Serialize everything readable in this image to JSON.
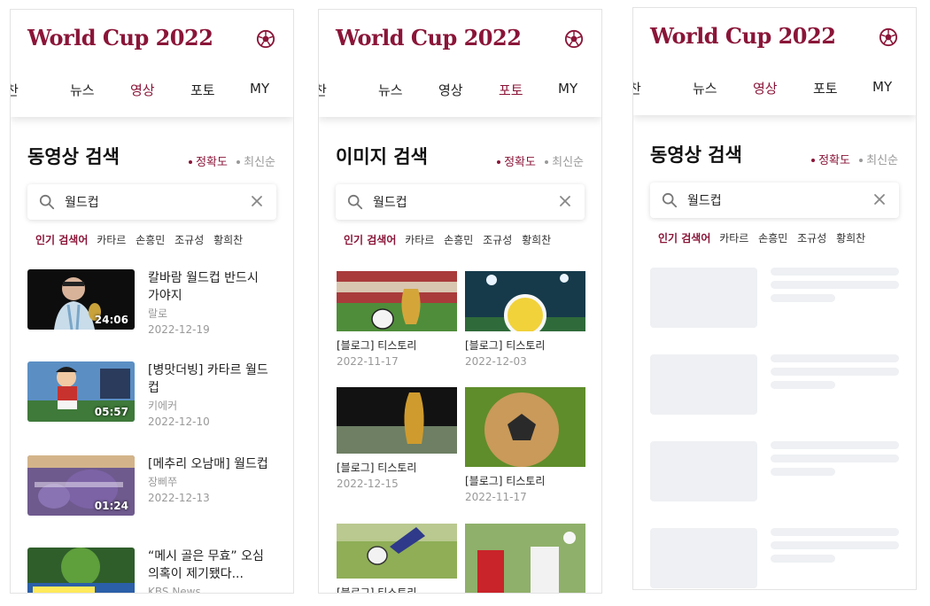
{
  "logo": "World Cup 2022",
  "tabs": [
    "찬",
    "뉴스",
    "영상",
    "포토",
    "MY"
  ],
  "sort": {
    "accuracy": "정확도",
    "latest": "최신순"
  },
  "search": {
    "value": "월드컵"
  },
  "popular": {
    "label": "인기 검색어",
    "keywords": [
      "카타르",
      "손흥민",
      "조규성",
      "황희찬"
    ]
  },
  "screens": [
    {
      "title": "동영상 검색",
      "active_tab": "영상",
      "videos": [
        {
          "title": "칼바람 월드컵 반드시 가야지",
          "channel": "랄로",
          "date": "2022-12-19",
          "duration": "24:06"
        },
        {
          "title": "[병맛더빙] 카타르 월드컵",
          "channel": "키에커",
          "date": "2022-12-10",
          "duration": "05:57"
        },
        {
          "title": "[메추리 오남매] 월드컵",
          "channel": "장삐쭈",
          "date": "2022-12-13",
          "duration": "01:24"
        },
        {
          "title": "“메시 골은 무효” 오심 의혹이 제기됐다...",
          "channel": "KBS News",
          "date": "",
          "duration": ""
        }
      ]
    },
    {
      "title": "이미지 검색",
      "active_tab": "포토",
      "images": [
        {
          "caption": "[블로그] 티스토리",
          "date": "2022-11-17"
        },
        {
          "caption": "[블로그] 티스토리",
          "date": "2022-12-03"
        },
        {
          "caption": "[블로그] 티스토리",
          "date": "2022-12-15"
        },
        {
          "caption": "[블로그] 티스토리",
          "date": "2022-11-17"
        },
        {
          "caption": "[블로그] 티스토리",
          "date": ""
        },
        {
          "caption": "",
          "date": ""
        }
      ]
    },
    {
      "title": "동영상 검색",
      "active_tab": "영상",
      "loading": true
    }
  ],
  "icons": {
    "brand": "soccer-ball-icon",
    "search": "search-icon",
    "clear": "close-icon"
  },
  "colors": {
    "brand": "#8a1538",
    "skeleton": "#eef0f3",
    "muted": "#999999"
  }
}
